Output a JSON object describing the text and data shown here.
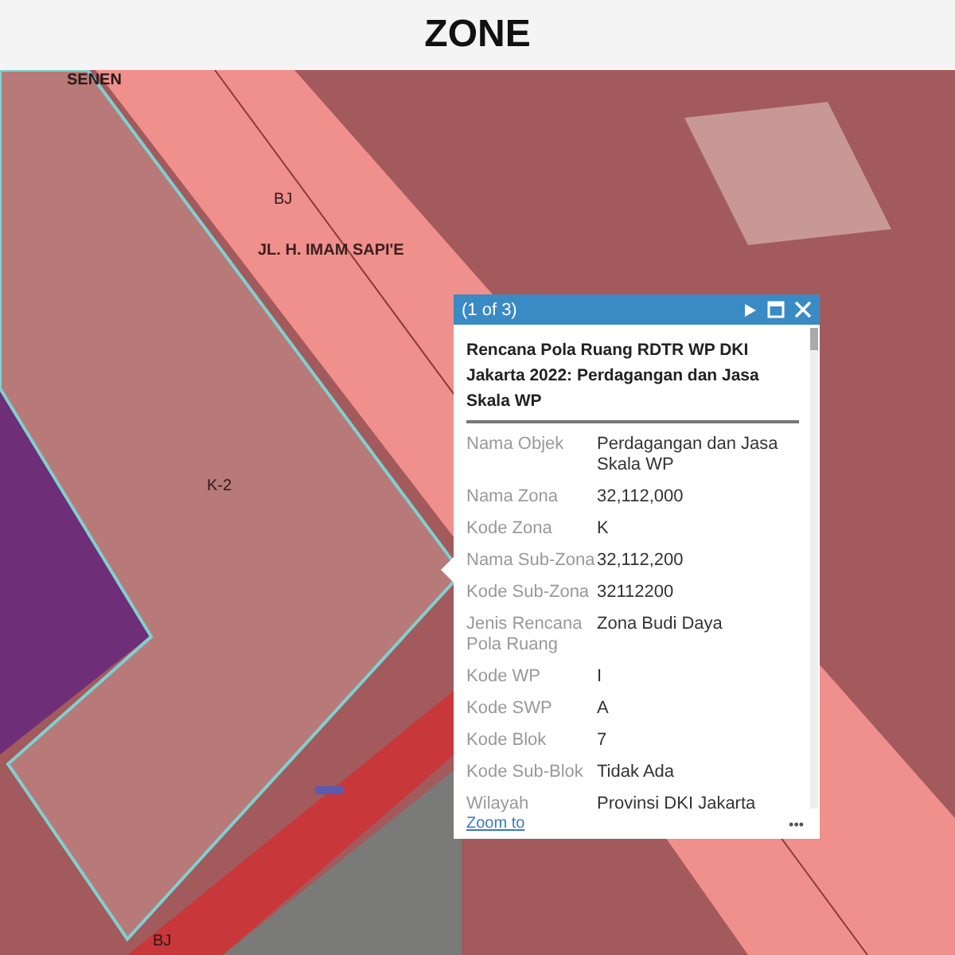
{
  "header": {
    "title": "ZONE"
  },
  "map_labels": [
    {
      "text": "SENEN",
      "kind": "area"
    },
    {
      "text": "BJ",
      "kind": "zone"
    },
    {
      "text": "JL. H. IMAM SAPI'E",
      "kind": "street"
    },
    {
      "text": "K-2",
      "kind": "zone"
    },
    {
      "text": "BJ",
      "kind": "zone"
    }
  ],
  "popup": {
    "counter": "(1 of 3)",
    "title": "Rencana Pola Ruang RDTR WP DKI Jakarta 2022: Perdagangan dan Jasa Skala WP",
    "fields": [
      {
        "label": "Nama Objek",
        "value": "Perdagangan dan Jasa Skala WP"
      },
      {
        "label": "Nama Zona",
        "value": "32,112,000"
      },
      {
        "label": "Kode Zona",
        "value": "K"
      },
      {
        "label": "Nama Sub-Zona",
        "value": "32,112,200"
      },
      {
        "label": "Kode Sub-Zona",
        "value": "32112200"
      },
      {
        "label": "Jenis Rencana Pola Ruang",
        "value": "Zona Budi Daya"
      },
      {
        "label": "Kode WP",
        "value": "I"
      },
      {
        "label": "Kode SWP",
        "value": "A"
      },
      {
        "label": "Kode Blok",
        "value": "7"
      },
      {
        "label": "Kode Sub-Blok",
        "value": "Tidak Ada"
      },
      {
        "label": "Wilayah",
        "value": "Provinsi DKI Jakarta"
      }
    ],
    "zoom_link": "Zoom to",
    "more": "•••"
  }
}
